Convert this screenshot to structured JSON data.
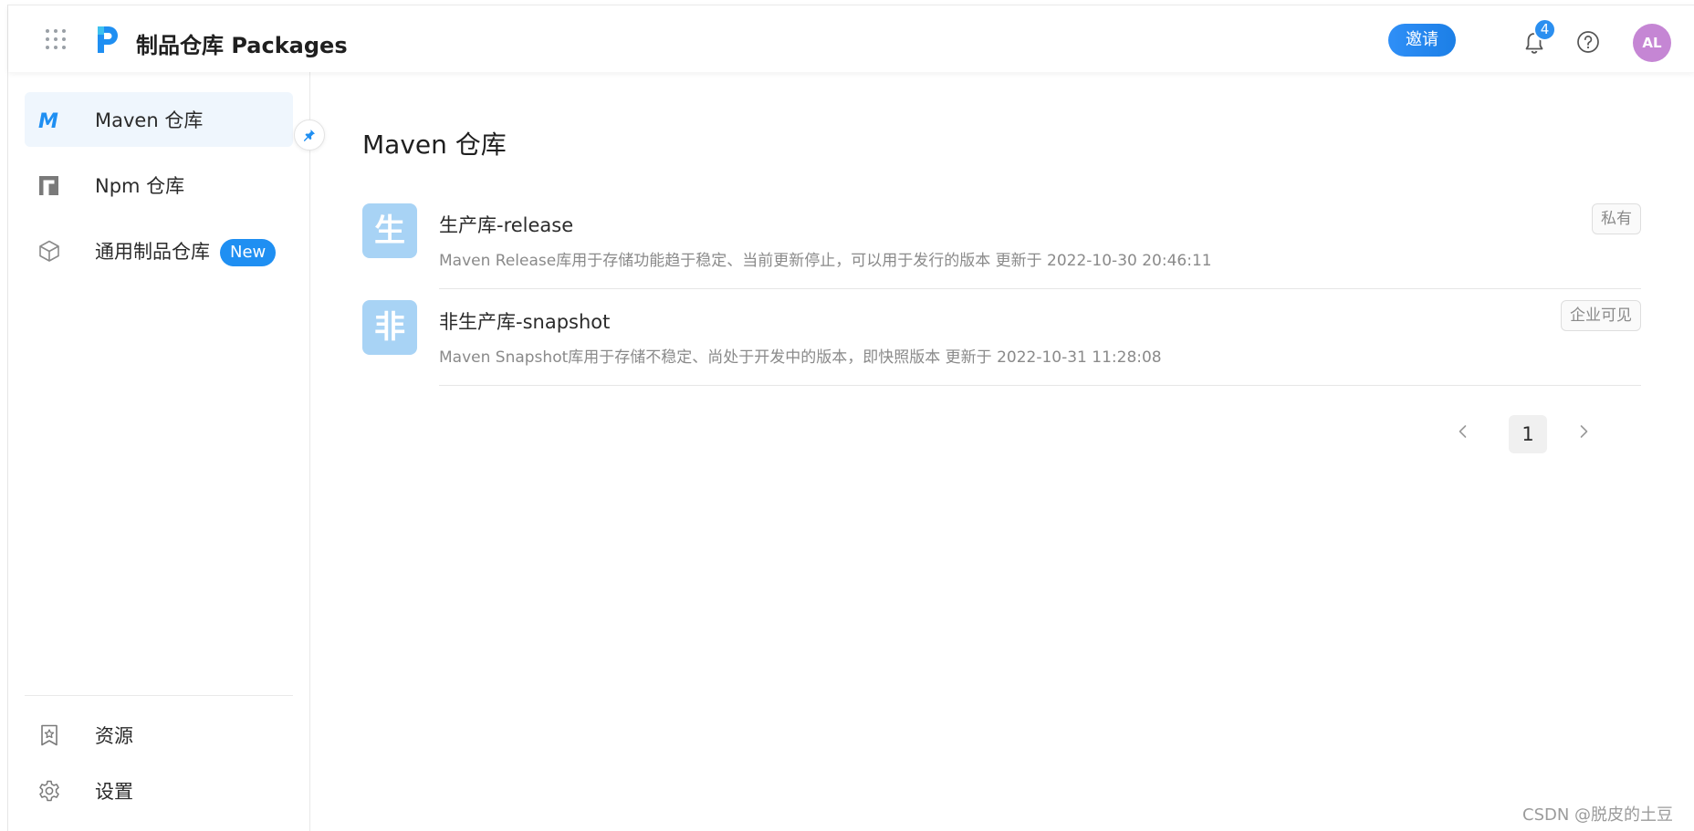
{
  "header": {
    "app_title": "制品仓库 Packages",
    "invite_label": "邀请",
    "notification_count": "4",
    "user_initials": "AL",
    "accent_color": "#1f8ff2",
    "avatar_color": "#c586d4"
  },
  "sidebar": {
    "items": [
      {
        "label": "Maven 仓库",
        "icon": "maven-icon",
        "active": true
      },
      {
        "label": "Npm 仓库",
        "icon": "npm-icon",
        "active": false
      },
      {
        "label": "通用制品仓库",
        "icon": "cube-icon",
        "active": false,
        "badge": "New"
      }
    ],
    "bottom_items": [
      {
        "label": "资源",
        "icon": "resource-icon"
      },
      {
        "label": "设置",
        "icon": "gear-icon"
      }
    ]
  },
  "main": {
    "title": "Maven 仓库",
    "repos": [
      {
        "avatar_char": "生",
        "name": "生产库-release",
        "description": "Maven Release库用于存储功能趋于稳定、当前更新停止，可以用于发行的版本",
        "updated_at": "更新于 2022-10-30 20:46:11",
        "visibility": "私有"
      },
      {
        "avatar_char": "非",
        "name": "非生产库-snapshot",
        "description": "Maven Snapshot库用于存储不稳定、尚处于开发中的版本，即快照版本",
        "updated_at": "更新于 2022-10-31 11:28:08",
        "visibility": "企业可见"
      }
    ],
    "pagination": {
      "current_page": "1"
    }
  },
  "watermark": "CSDN @脱皮的土豆"
}
